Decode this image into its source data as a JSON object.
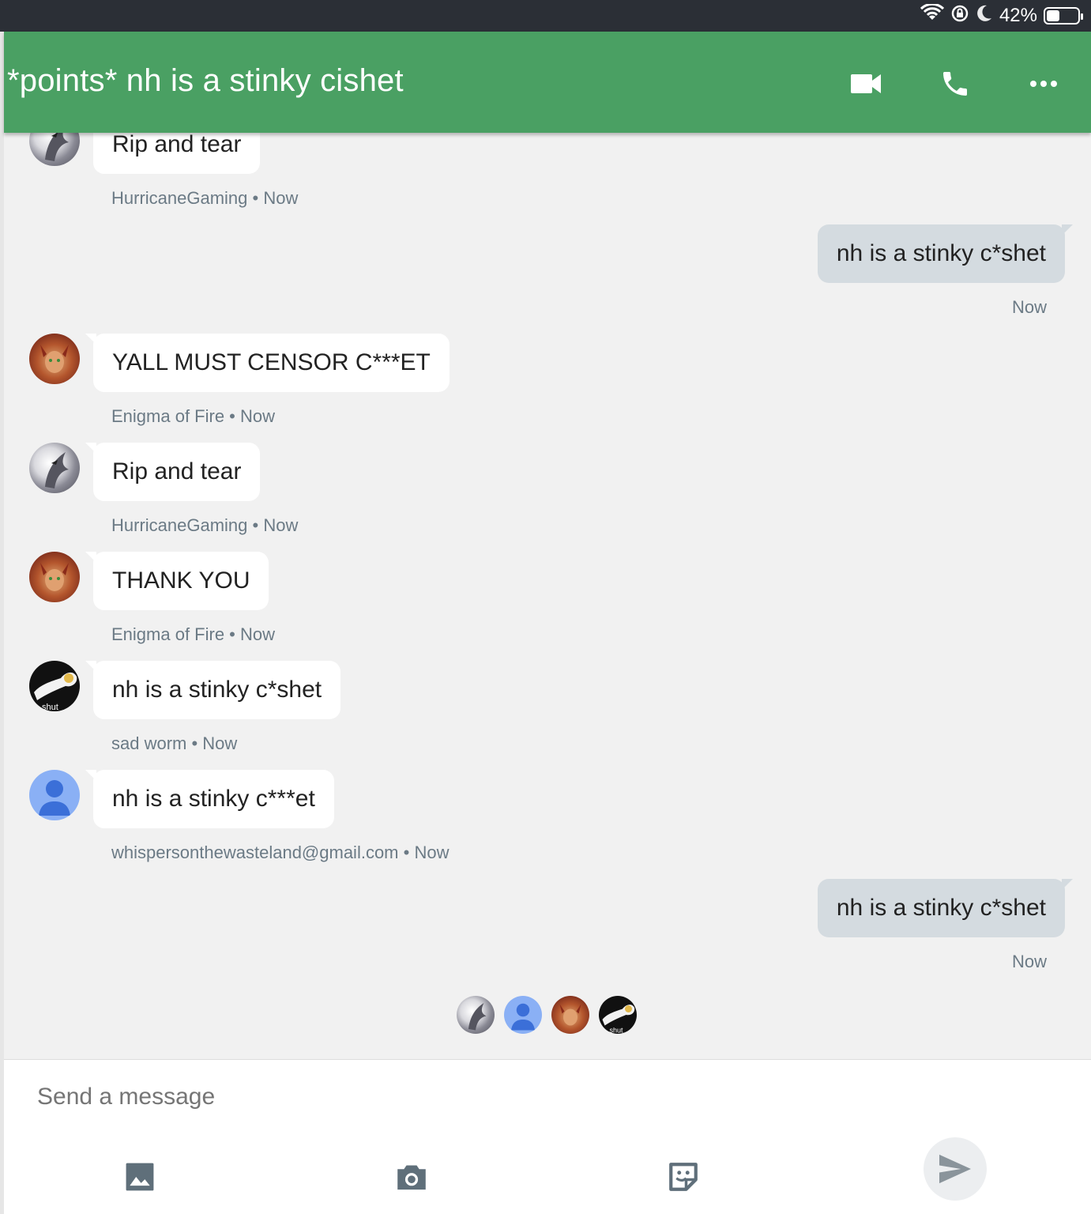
{
  "status_bar": {
    "battery_percent_label": "42%",
    "battery_level": 0.42
  },
  "header": {
    "title": "*points* nh is a stinky cishet"
  },
  "messages": [
    {
      "text": "Rip and tear",
      "sender": "HurricaneGaming",
      "time": "Now"
    },
    {
      "text": "nh is a stinky c*shet",
      "time": "Now"
    },
    {
      "text": "YALL MUST CENSOR C***ET",
      "sender": "Enigma of Fire",
      "time": "Now"
    },
    {
      "text": "Rip and tear",
      "sender": "HurricaneGaming",
      "time": "Now"
    },
    {
      "text": "THANK YOU",
      "sender": "Enigma of Fire",
      "time": "Now"
    },
    {
      "text": "nh is a stinky c*shet",
      "sender": "sad worm",
      "time": "Now",
      "avatar_caption": "shut"
    },
    {
      "text": "nh is a stinky c***et",
      "sender": "whispersonthewasteland@gmail.com",
      "time": "Now"
    },
    {
      "text": "nh is a stinky c*shet",
      "time": "Now"
    }
  ],
  "read_receipts": {
    "worm_caption": "shut"
  },
  "composer": {
    "placeholder": "Send a message"
  },
  "colors": {
    "header": "#4aa063",
    "status_bar": "#2b2f36",
    "outgoing_bubble": "#d4dbe0",
    "incoming_bubble": "#ffffff",
    "background": "#f1f1f1"
  },
  "icons": [
    "wifi-icon",
    "rotation-lock-icon",
    "moon-icon",
    "battery-icon",
    "video-call-icon",
    "phone-icon",
    "more-icon",
    "image-icon",
    "camera-icon",
    "sticker-icon",
    "send-icon"
  ],
  "sep": " • "
}
